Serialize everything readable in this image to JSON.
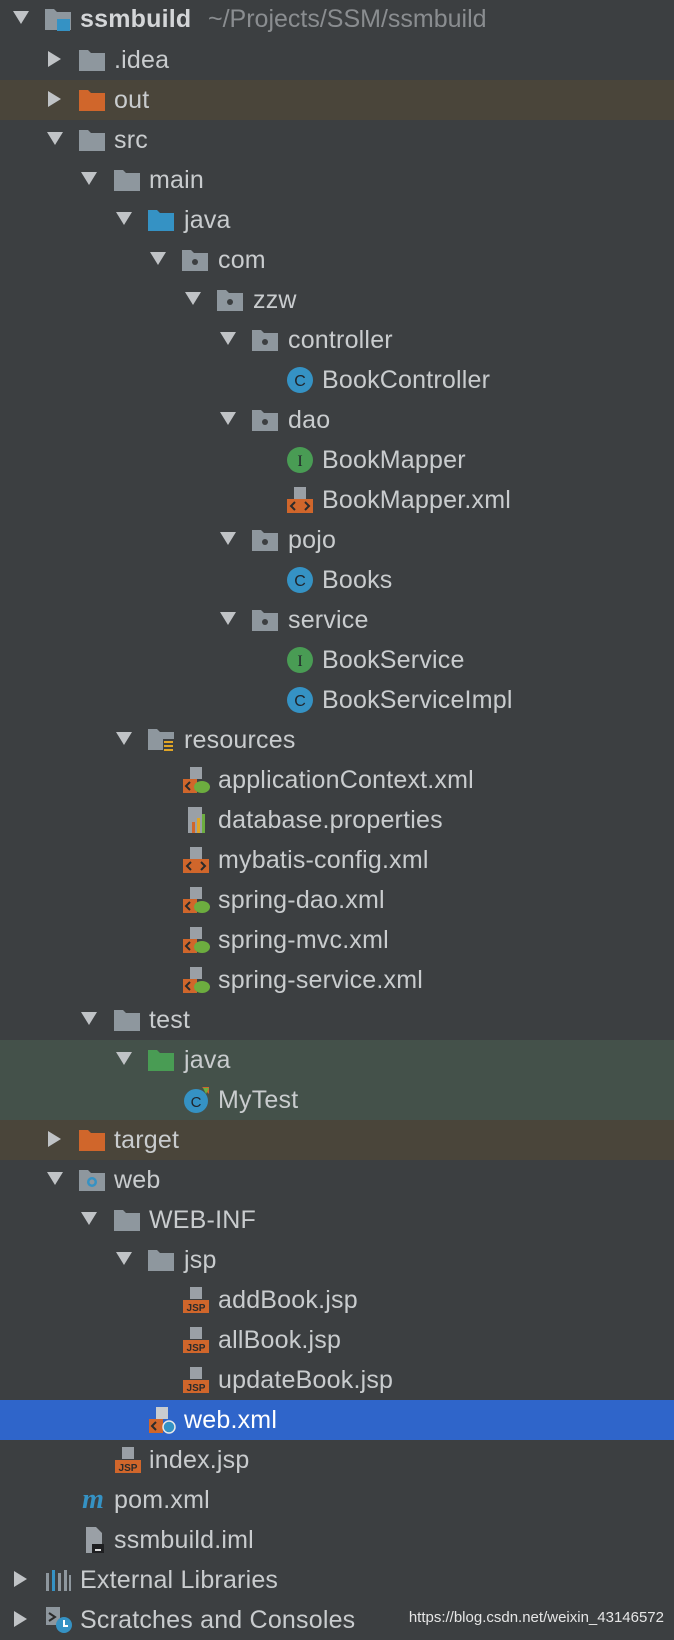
{
  "project": {
    "name": "ssmbuild",
    "path": "~/Projects/SSM/ssmbuild"
  },
  "nodes": {
    "idea": ".idea",
    "out": "out",
    "src": "src",
    "main": "main",
    "java_main": "java",
    "com": "com",
    "zzw": "zzw",
    "controller": "controller",
    "book_controller": "BookController",
    "dao": "dao",
    "book_mapper": "BookMapper",
    "book_mapper_xml": "BookMapper.xml",
    "pojo": "pojo",
    "books": "Books",
    "service": "service",
    "book_service": "BookService",
    "book_service_impl": "BookServiceImpl",
    "resources": "resources",
    "application_context": "applicationContext.xml",
    "database_properties": "database.properties",
    "mybatis_config": "mybatis-config.xml",
    "spring_dao": "spring-dao.xml",
    "spring_mvc": "spring-mvc.xml",
    "spring_service": "spring-service.xml",
    "test": "test",
    "java_test": "java",
    "my_test": "MyTest",
    "target": "target",
    "web": "web",
    "web_inf": "WEB-INF",
    "jsp": "jsp",
    "add_book": "addBook.jsp",
    "all_book": "allBook.jsp",
    "update_book": "updateBook.jsp",
    "web_xml": "web.xml",
    "index_jsp": "index.jsp",
    "pom": "pom.xml",
    "iml": "ssmbuild.iml",
    "external_libraries": "External Libraries",
    "scratches": "Scratches and Consoles"
  },
  "icon_glyphs": {
    "class_letter": "C",
    "interface_letter": "I",
    "maven_letter": "m",
    "jsp_badge": "JSP"
  },
  "watermark": "https://blog.csdn.net/weixin_43146572",
  "colors": {
    "background": "#3c3f41",
    "selected_row": "#2f65ca",
    "excluded_row": "#4a453a",
    "test_row": "#44514a",
    "folder": "#8e979e",
    "excluded_folder": "#d0662b",
    "source_folder": "#3592c4",
    "test_folder": "#499c54",
    "class_icon": "#3592c4",
    "interface_icon": "#499c54"
  }
}
